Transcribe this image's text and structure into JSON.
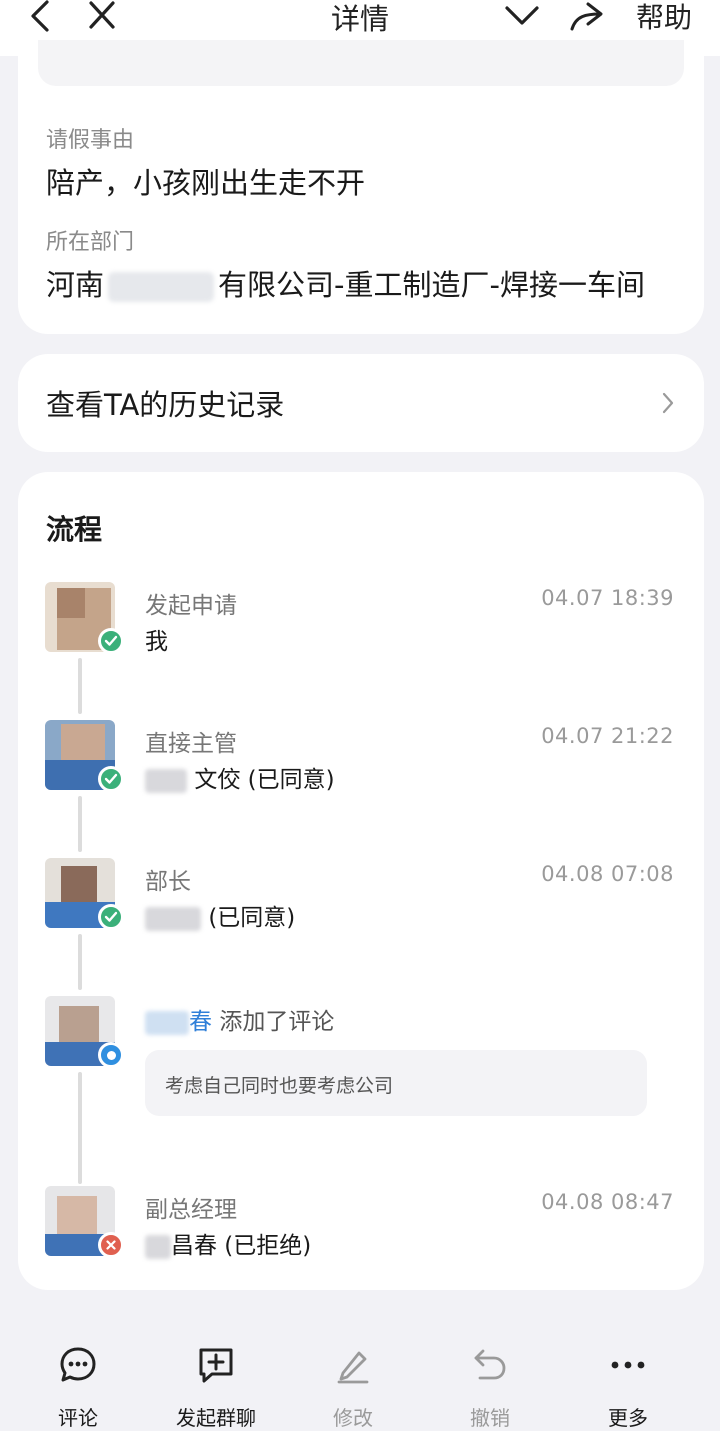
{
  "header": {
    "title": "详情",
    "help_label": "帮助",
    "icons": [
      "back-icon",
      "close-icon",
      "chevron-down-icon",
      "share-icon"
    ]
  },
  "details": {
    "reason_label": "请假事由",
    "reason_value": "陪产，小孩刚出生走不开",
    "dept_label": "所在部门",
    "dept_value_prefix": "河南",
    "dept_value_suffix": "有限公司-重工制造厂-焊接一车间"
  },
  "history": {
    "label": "查看TA的历史记录"
  },
  "process": {
    "title": "流程",
    "steps": [
      {
        "title": "发起申请",
        "name": "我",
        "time": "04.07 18:39",
        "status": "approved"
      },
      {
        "title": "直接主管",
        "name": "文佼 (已同意)",
        "time": "04.07 21:22",
        "status": "approved"
      },
      {
        "title": "部长",
        "name": "(已同意)",
        "time": "04.08 07:08",
        "status": "approved"
      },
      {
        "title": "",
        "commenter": "春",
        "action": "添加了评论",
        "comment": "考虑自己同时也要考虑公司",
        "status": "comment"
      },
      {
        "title": "副总经理",
        "name": "昌春 (已拒绝)",
        "time": "04.08 08:47",
        "status": "rejected"
      }
    ]
  },
  "toolbar": {
    "comment_label": "评论",
    "group_chat_label": "发起群聊",
    "edit_label": "修改",
    "revoke_label": "撤销",
    "more_label": "更多"
  },
  "colors": {
    "approved": "#3bb07a",
    "rejected": "#e06050",
    "comment": "#2f8fe0",
    "link": "#2f7fd8"
  }
}
